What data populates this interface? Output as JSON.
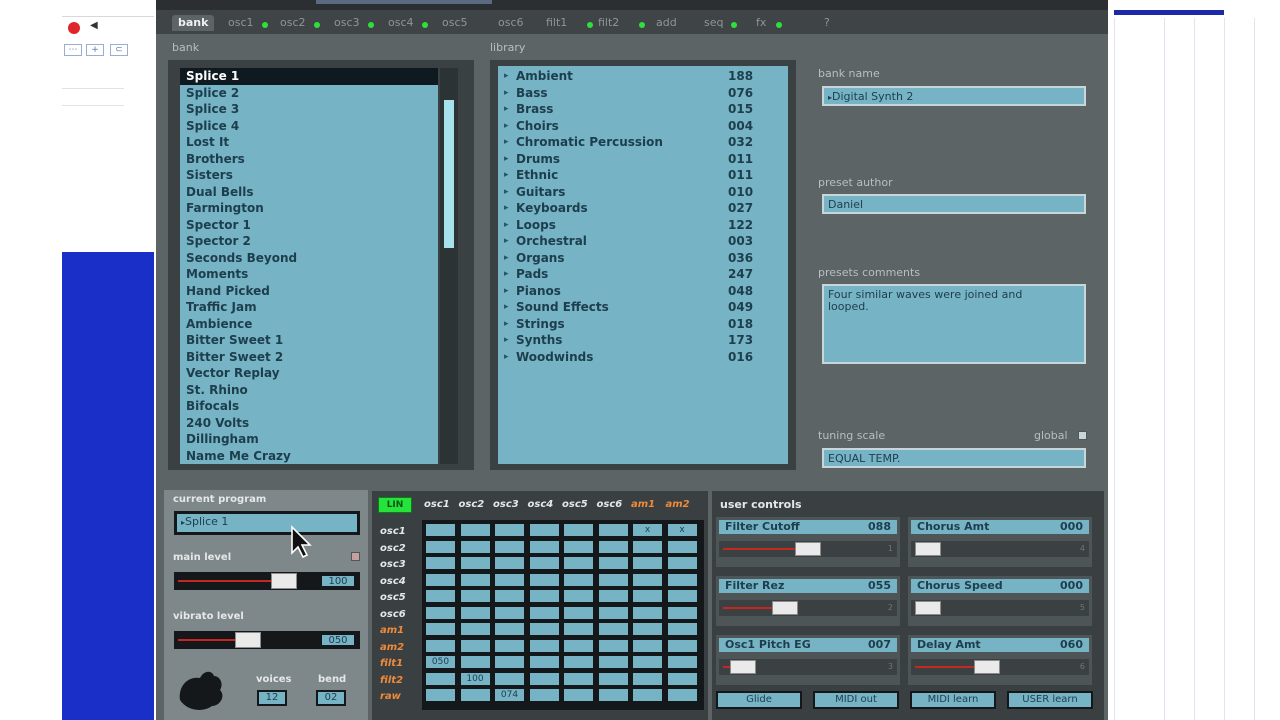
{
  "tabs": [
    {
      "label": "bank",
      "active": true
    },
    {
      "label": "osc1",
      "led": true
    },
    {
      "label": "osc2",
      "led": true
    },
    {
      "label": "osc3",
      "led": true
    },
    {
      "label": "osc4",
      "led": true
    },
    {
      "label": "osc5",
      "led": false
    },
    {
      "label": "osc6",
      "led": false
    },
    {
      "label": "filt1",
      "led": true
    },
    {
      "label": "filt2",
      "led": true
    },
    {
      "label": "add",
      "led": false
    },
    {
      "label": "seq",
      "led": true
    },
    {
      "label": "fx",
      "led": true
    },
    {
      "label": "?",
      "led": false
    }
  ],
  "bank": {
    "label": "bank",
    "items": [
      "Splice 1",
      "Splice 2",
      "Splice 3",
      "Splice 4",
      "Lost It",
      "Brothers",
      "Sisters",
      "Dual Bells",
      "Farmington",
      "Spector 1",
      "Spector 2",
      "Seconds Beyond",
      "Moments",
      "Hand Picked",
      "Traffic Jam",
      "Ambience",
      "Bitter Sweet 1",
      "Bitter Sweet 2",
      "Vector Replay",
      "St. Rhino",
      "Bifocals",
      "240 Volts",
      "Dillingham",
      "Name Me Crazy"
    ],
    "selected": 0
  },
  "library": {
    "label": "library",
    "items": [
      {
        "name": "Ambient",
        "count": "188"
      },
      {
        "name": "Bass",
        "count": "076"
      },
      {
        "name": "Brass",
        "count": "015"
      },
      {
        "name": "Choirs",
        "count": "004"
      },
      {
        "name": "Chromatic Percussion",
        "count": "032"
      },
      {
        "name": "Drums",
        "count": "011"
      },
      {
        "name": "Ethnic",
        "count": "011"
      },
      {
        "name": "Guitars",
        "count": "010"
      },
      {
        "name": "Keyboards",
        "count": "027"
      },
      {
        "name": "Loops",
        "count": "122"
      },
      {
        "name": "Orchestral",
        "count": "003"
      },
      {
        "name": "Organs",
        "count": "036"
      },
      {
        "name": "Pads",
        "count": "247"
      },
      {
        "name": "Pianos",
        "count": "048"
      },
      {
        "name": "Sound Effects",
        "count": "049"
      },
      {
        "name": "Strings",
        "count": "018"
      },
      {
        "name": "Synths",
        "count": "173"
      },
      {
        "name": "Woodwinds",
        "count": "016"
      }
    ]
  },
  "info": {
    "bank_name_label": "bank name",
    "bank_name": "Digital Synth 2",
    "author_label": "preset author",
    "author": "Daniel",
    "comments_label": "presets comments",
    "comments": "Four similar waves were joined and looped.",
    "tuning_label": "tuning scale",
    "global_label": "global",
    "tuning": "EQUAL TEMP."
  },
  "program": {
    "current_label": "current program",
    "current": "Splice 1",
    "main_level_label": "main level",
    "main_level": "100",
    "main_level_fraction": 0.82,
    "vibrato_label": "vibrato level",
    "vibrato": "050",
    "vibrato_fraction": 0.5,
    "voices_label": "voices",
    "voices": "12",
    "bend_label": "bend",
    "bend": "02"
  },
  "matrix": {
    "lin_label": "LIN",
    "columns": [
      {
        "label": "osc1",
        "orange": false
      },
      {
        "label": "osc2",
        "orange": false
      },
      {
        "label": "osc3",
        "orange": false
      },
      {
        "label": "osc4",
        "orange": false
      },
      {
        "label": "osc5",
        "orange": false
      },
      {
        "label": "osc6",
        "orange": false
      },
      {
        "label": "am1",
        "orange": true
      },
      {
        "label": "am2",
        "orange": true
      }
    ],
    "rows": [
      {
        "label": "osc1",
        "orange": false
      },
      {
        "label": "osc2",
        "orange": false
      },
      {
        "label": "osc3",
        "orange": false
      },
      {
        "label": "osc4",
        "orange": false
      },
      {
        "label": "osc5",
        "orange": false
      },
      {
        "label": "osc6",
        "orange": false
      },
      {
        "label": "am1",
        "orange": true
      },
      {
        "label": "am2",
        "orange": true
      },
      {
        "label": "filt1",
        "orange": true
      },
      {
        "label": "filt2",
        "orange": true
      },
      {
        "label": "raw",
        "orange": true
      }
    ],
    "values": [
      {
        "row": 0,
        "col": 6,
        "text": "x"
      },
      {
        "row": 0,
        "col": 7,
        "text": "x"
      },
      {
        "row": 8,
        "col": 0,
        "text": "050"
      },
      {
        "row": 9,
        "col": 1,
        "text": "100"
      },
      {
        "row": 10,
        "col": 2,
        "text": "074"
      }
    ]
  },
  "user_controls": {
    "label": "user controls",
    "controls": [
      {
        "name": "Filter Cutoff",
        "value": "088",
        "fraction": 0.55,
        "tick": "1"
      },
      {
        "name": "Chorus Amt",
        "value": "000",
        "fraction": 0.0,
        "tick": "4"
      },
      {
        "name": "Filter Rez",
        "value": "055",
        "fraction": 0.38,
        "tick": "2"
      },
      {
        "name": "Chorus Speed",
        "value": "000",
        "fraction": 0.0,
        "tick": "5"
      },
      {
        "name": "Osc1 Pitch EG",
        "value": "007",
        "fraction": 0.05,
        "tick": "3"
      },
      {
        "name": "Delay Amt",
        "value": "060",
        "fraction": 0.45,
        "tick": "6"
      }
    ],
    "buttons": [
      "Glide",
      "MIDI out",
      "MIDI learn",
      "USER learn"
    ]
  },
  "colors": {
    "lcd": "#76b3c5",
    "panel": "#5c6466",
    "led_on": "#2fe03c",
    "accent_orange": "#ef8a3a",
    "slider_red": "#c5281f"
  }
}
